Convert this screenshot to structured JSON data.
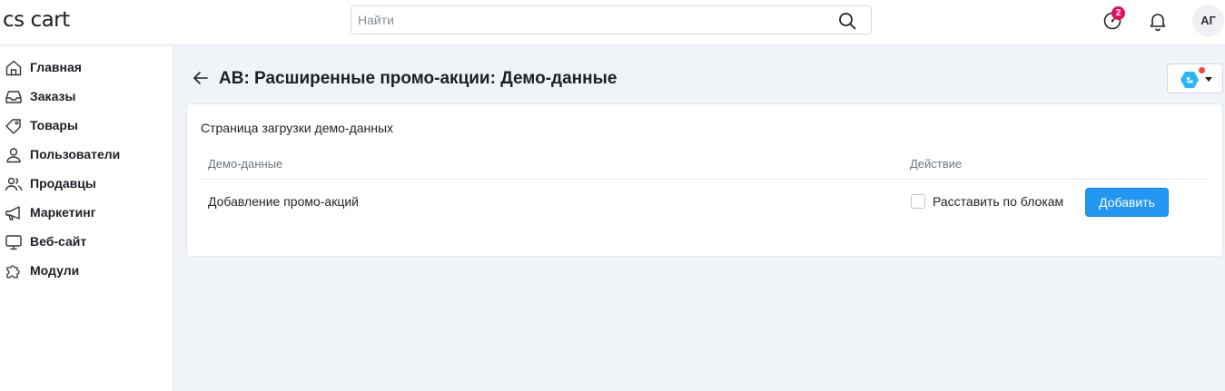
{
  "header": {
    "logo": "cs cart",
    "search": {
      "placeholder": "Найти",
      "value": ""
    },
    "notification_badge": "2",
    "avatar_initials": "АГ"
  },
  "sidebar": {
    "items": [
      {
        "label": "Главная",
        "icon": "home-icon"
      },
      {
        "label": "Заказы",
        "icon": "inbox-icon"
      },
      {
        "label": "Товары",
        "icon": "tag-icon"
      },
      {
        "label": "Пользователи",
        "icon": "user-icon"
      },
      {
        "label": "Продавцы",
        "icon": "users-icon"
      },
      {
        "label": "Маркетинг",
        "icon": "megaphone-icon"
      },
      {
        "label": "Веб-сайт",
        "icon": "monitor-icon"
      },
      {
        "label": "Модули",
        "icon": "puzzle-icon"
      }
    ]
  },
  "page": {
    "title": "AB: Расширенные промо-акции: Демо-данные",
    "description": "Страница загрузки демо-данных",
    "table": {
      "columns": [
        "Демо-данные",
        "Действие"
      ],
      "rows": [
        {
          "name": "Добавление промо-акций",
          "checkbox_label": "Расставить по блокам",
          "checked": false,
          "button": "Добавить"
        }
      ]
    }
  },
  "colors": {
    "accent": "#2196f3",
    "badge": "#e0115f",
    "background": "#f0f3f8",
    "addon_hex": "#29b6f6"
  }
}
